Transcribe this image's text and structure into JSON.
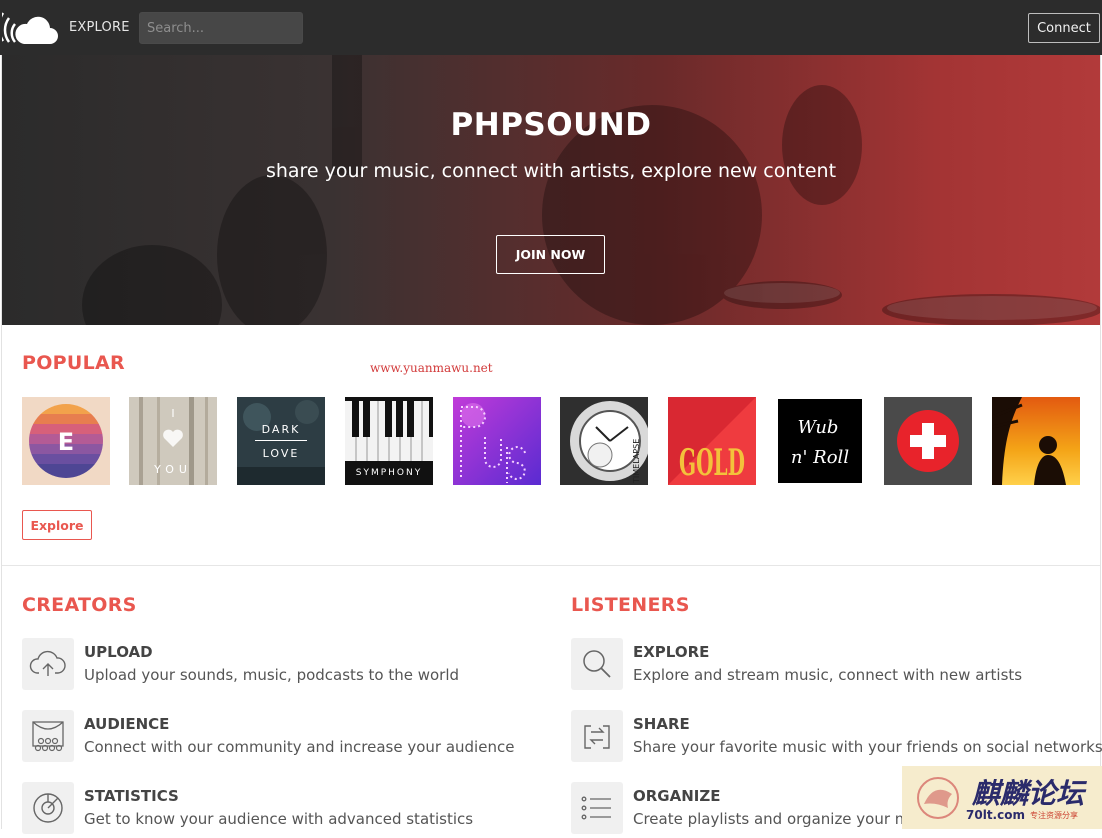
{
  "nav": {
    "explore_label": "EXPLORE",
    "search_placeholder": "Search...",
    "connect_label": "Connect"
  },
  "hero": {
    "title": "PHPSOUND",
    "subtitle": "share your music, connect with artists, explore new content",
    "cta_label": "JOIN NOW"
  },
  "popular": {
    "title": "POPULAR",
    "watermark": "www.yuanmawu.net",
    "explore_label": "Explore",
    "tiles": [
      {
        "name": "e-album",
        "label": "E"
      },
      {
        "name": "i-love-you",
        "label": "I YOU"
      },
      {
        "name": "dark-love",
        "label_1": "DARK",
        "label_2": "LOVE"
      },
      {
        "name": "symphony",
        "label": "SYMPHONY"
      },
      {
        "name": "pulse",
        "label": "PULSE"
      },
      {
        "name": "timelapse",
        "label": "TIMELAPSE"
      },
      {
        "name": "gold",
        "label": "GOLD"
      },
      {
        "name": "wub-n-roll",
        "label_1": "Wub",
        "label_2": "n' Roll"
      },
      {
        "name": "plus-cross",
        "label": ""
      },
      {
        "name": "sunset-silhouette",
        "label": ""
      }
    ]
  },
  "creators": {
    "title": "CREATORS",
    "items": [
      {
        "title": "UPLOAD",
        "desc": "Upload your sounds, music, podcasts to the world",
        "icon": "cloud-upload-icon"
      },
      {
        "title": "AUDIENCE",
        "desc": "Connect with our community and increase your audience",
        "icon": "audience-icon"
      },
      {
        "title": "STATISTICS",
        "desc": "Get to know your audience with advanced statistics",
        "icon": "statistics-icon"
      }
    ]
  },
  "listeners": {
    "title": "LISTENERS",
    "items": [
      {
        "title": "EXPLORE",
        "desc": "Explore and stream music, connect with new artists",
        "icon": "search-icon"
      },
      {
        "title": "SHARE",
        "desc": "Share your favorite music with your friends on social networks",
        "icon": "share-icon"
      },
      {
        "title": "ORGANIZE",
        "desc": "Create playlists and organize your music",
        "icon": "list-icon"
      }
    ]
  },
  "badge": {
    "text_1": "麒麟论坛",
    "text_2": "70lt.com",
    "text_3": "专注资源分享"
  },
  "colors": {
    "accent": "#e9574f",
    "topbar": "#2c2c2c",
    "hero_red": "#b23a3a"
  }
}
